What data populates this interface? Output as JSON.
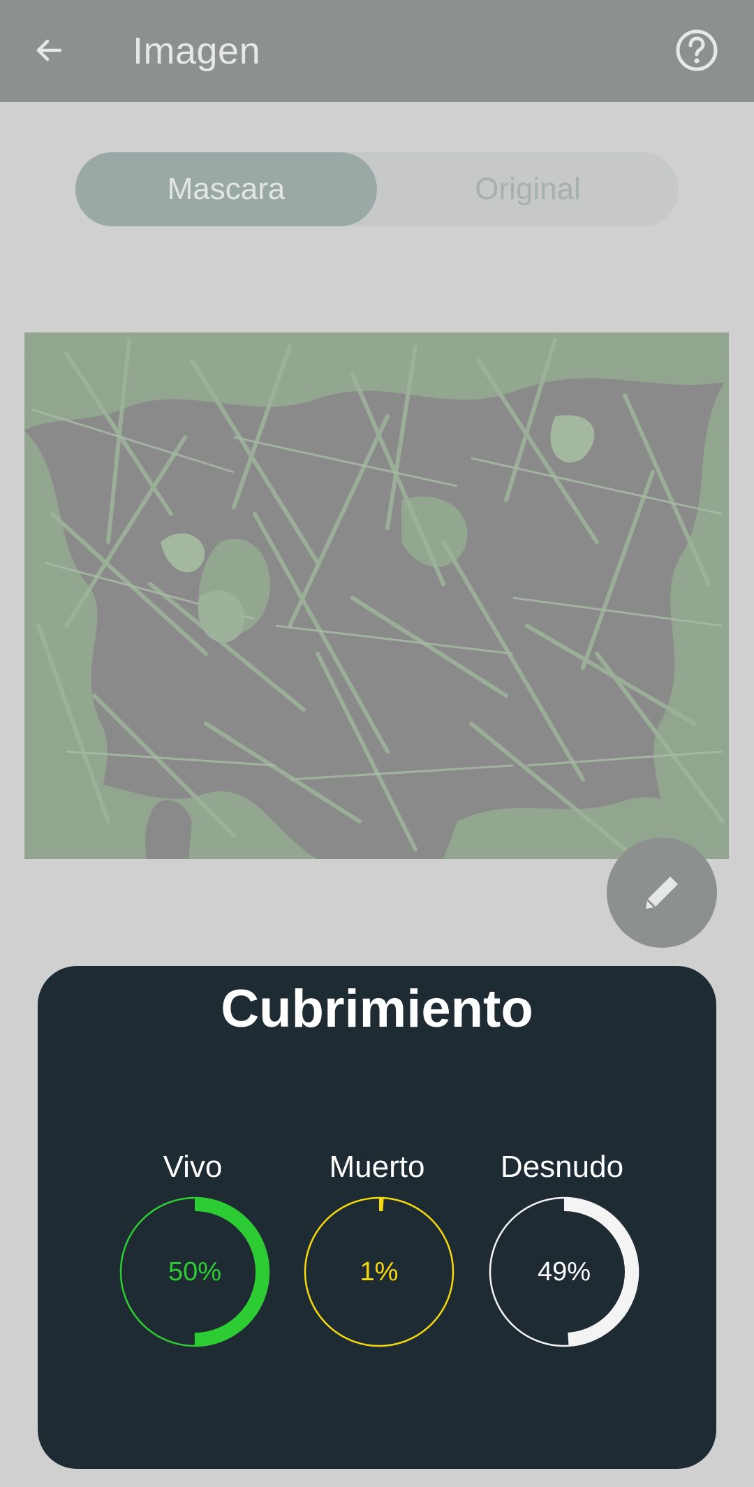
{
  "appbar": {
    "title": "Imagen"
  },
  "tabs": [
    {
      "label": "Mascara",
      "selected": true
    },
    {
      "label": "Original",
      "selected": false
    }
  ],
  "card": {
    "title": "Cubrimiento",
    "metrics": [
      {
        "label": "Vivo",
        "value_text": "50%",
        "fraction": 0.5,
        "color": "#2ecc34"
      },
      {
        "label": "Muerto",
        "value_text": "1%",
        "fraction": 0.01,
        "color": "#f5d90f"
      },
      {
        "label": "Desnudo",
        "value_text": "49%",
        "fraction": 0.49,
        "color": "#f4f4f4"
      }
    ]
  },
  "icons": {
    "back": "arrow-back-icon",
    "help": "help-circle-icon",
    "edit": "pencil-icon"
  },
  "colors": {
    "appbar": "#8c9190",
    "card": "#1f2b32"
  }
}
